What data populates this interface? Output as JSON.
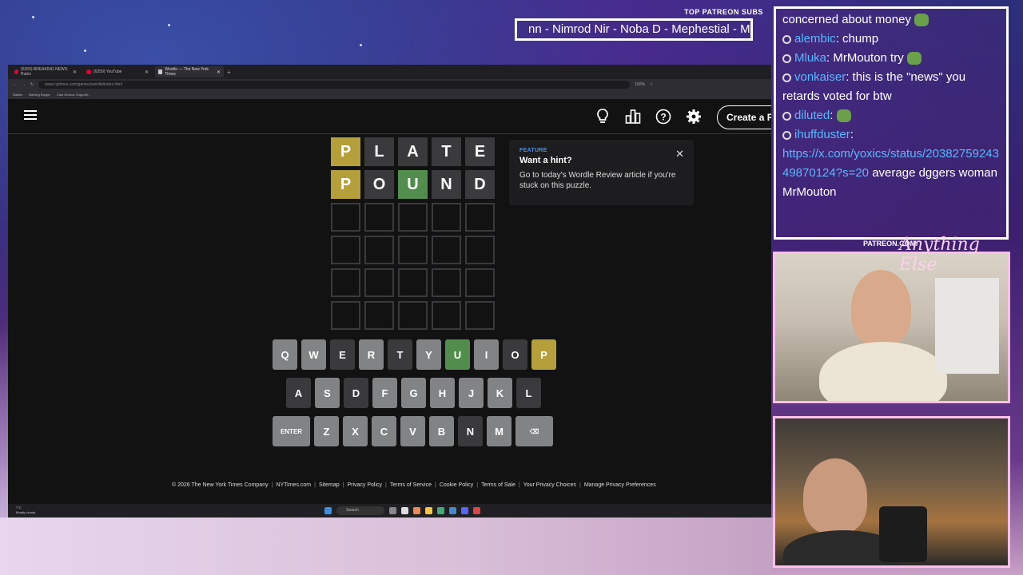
{
  "overlay": {
    "patreon_label": "TOP PATREON SUBS",
    "patreon_ticker": "nn - Nimrod Nir - Noba D - Mephestial - M",
    "patreon_url": "PATREON.COM/",
    "brand_signature": "Anything Else"
  },
  "browser": {
    "tabs": [
      {
        "label": "(6260) BREAKING NEWS: Rubio"
      },
      {
        "label": "(6259) YouTube"
      },
      {
        "label": "Wordle — The New York Times"
      }
    ],
    "url": "www.nytimes.com/games/wordle/index.html",
    "zoom": "160%",
    "bookmarks": [
      "Dailies",
      "Nothing Burger",
      "Clair Obscur: Expediti..."
    ]
  },
  "wordle": {
    "create_button": "Create a Puzzle",
    "board": [
      [
        {
          "l": "P",
          "s": "yellow"
        },
        {
          "l": "L",
          "s": "gray"
        },
        {
          "l": "A",
          "s": "gray"
        },
        {
          "l": "T",
          "s": "gray"
        },
        {
          "l": "E",
          "s": "gray"
        }
      ],
      [
        {
          "l": "P",
          "s": "yellow"
        },
        {
          "l": "O",
          "s": "gray"
        },
        {
          "l": "U",
          "s": "green"
        },
        {
          "l": "N",
          "s": "gray"
        },
        {
          "l": "D",
          "s": "gray"
        }
      ],
      [
        {
          "l": "",
          "s": "empty"
        },
        {
          "l": "",
          "s": "empty"
        },
        {
          "l": "",
          "s": "empty"
        },
        {
          "l": "",
          "s": "empty"
        },
        {
          "l": "",
          "s": "empty"
        }
      ],
      [
        {
          "l": "",
          "s": "empty"
        },
        {
          "l": "",
          "s": "empty"
        },
        {
          "l": "",
          "s": "empty"
        },
        {
          "l": "",
          "s": "empty"
        },
        {
          "l": "",
          "s": "empty"
        }
      ],
      [
        {
          "l": "",
          "s": "empty"
        },
        {
          "l": "",
          "s": "empty"
        },
        {
          "l": "",
          "s": "empty"
        },
        {
          "l": "",
          "s": "empty"
        },
        {
          "l": "",
          "s": "empty"
        }
      ],
      [
        {
          "l": "",
          "s": "empty"
        },
        {
          "l": "",
          "s": "empty"
        },
        {
          "l": "",
          "s": "empty"
        },
        {
          "l": "",
          "s": "empty"
        },
        {
          "l": "",
          "s": "empty"
        }
      ]
    ],
    "hint": {
      "tag": "FEATURE",
      "title": "Want a hint?",
      "body": "Go to today's Wordle Review article if you're stuck on this puzzle.",
      "close": "✕"
    },
    "keyboard": [
      [
        {
          "k": "Q",
          "s": "unused"
        },
        {
          "k": "W",
          "s": "unused"
        },
        {
          "k": "E",
          "s": "absent"
        },
        {
          "k": "R",
          "s": "unused"
        },
        {
          "k": "T",
          "s": "absent"
        },
        {
          "k": "Y",
          "s": "unused"
        },
        {
          "k": "U",
          "s": "green"
        },
        {
          "k": "I",
          "s": "unused"
        },
        {
          "k": "O",
          "s": "absent"
        },
        {
          "k": "P",
          "s": "yellow"
        }
      ],
      [
        {
          "k": "A",
          "s": "absent"
        },
        {
          "k": "S",
          "s": "unused"
        },
        {
          "k": "D",
          "s": "absent"
        },
        {
          "k": "F",
          "s": "unused"
        },
        {
          "k": "G",
          "s": "unused"
        },
        {
          "k": "H",
          "s": "unused"
        },
        {
          "k": "J",
          "s": "unused"
        },
        {
          "k": "K",
          "s": "unused"
        },
        {
          "k": "L",
          "s": "absent"
        }
      ],
      [
        {
          "k": "ENTER",
          "s": "unused",
          "wide": true
        },
        {
          "k": "Z",
          "s": "unused"
        },
        {
          "k": "X",
          "s": "unused"
        },
        {
          "k": "C",
          "s": "unused"
        },
        {
          "k": "V",
          "s": "unused"
        },
        {
          "k": "B",
          "s": "unused"
        },
        {
          "k": "N",
          "s": "absent"
        },
        {
          "k": "M",
          "s": "unused"
        },
        {
          "k": "⌫",
          "s": "unused",
          "wide": true
        }
      ]
    ],
    "footer": [
      "© 2026 The New York Times Company",
      "NYTimes.com",
      "Sitemap",
      "Privacy Policy",
      "Terms of Service",
      "Cookie Policy",
      "Terms of Sale",
      "Your Privacy Choices",
      "Manage Privacy Preferences"
    ]
  },
  "taskbar": {
    "weather_temp": "7°C",
    "weather_desc": "Mostly cloudy",
    "search_label": "Search"
  },
  "chat": [
    {
      "user": "",
      "text": "concerned about money",
      "emote": true,
      "prefix": "",
      "cont": true
    },
    {
      "user": "alembic",
      "text": "chump"
    },
    {
      "user": "Mluka",
      "text": "MrMouton try",
      "emote": true
    },
    {
      "user": "vonkaiser",
      "text": "this is the \"news\" you retards voted for btw"
    },
    {
      "user": "diluted",
      "text": "",
      "emote": true
    },
    {
      "user": "ihuffduster",
      "text": "",
      "link": "https://x.com/yoxics/status/2038275924349870124?s=20",
      "after": "average dggers woman MrMouton"
    }
  ]
}
